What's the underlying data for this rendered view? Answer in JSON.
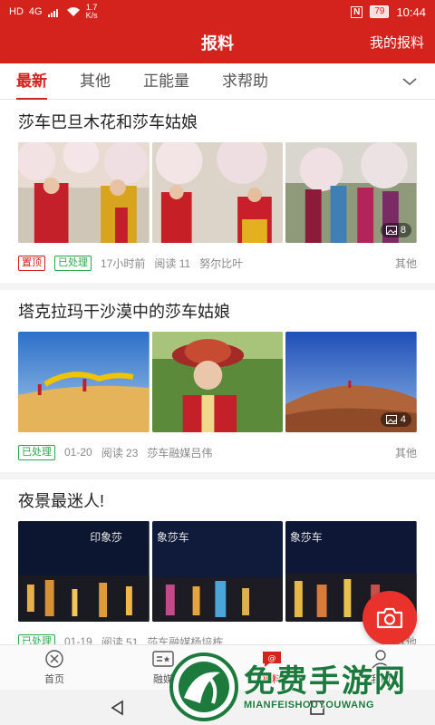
{
  "status_bar": {
    "signal_label": "HD",
    "network": "4G",
    "speed_value": "1.7",
    "speed_unit": "K/s",
    "nfc": "N",
    "battery": "79",
    "time": "10:44"
  },
  "header": {
    "title": "报料",
    "right_link": "我的报料"
  },
  "tabs": [
    {
      "label": "最新",
      "active": true
    },
    {
      "label": "其他",
      "active": false
    },
    {
      "label": "正能量",
      "active": false
    },
    {
      "label": "求帮助",
      "active": false
    }
  ],
  "posts": [
    {
      "title": "莎车巴旦木花和莎车姑娘",
      "image_count": "8",
      "badges": [
        "置顶",
        "已处理"
      ],
      "time": "17小时前",
      "reads": "阅读 11",
      "author": "努尔比叶",
      "category": "其他"
    },
    {
      "title": "塔克拉玛干沙漠中的莎车姑娘",
      "image_count": "4",
      "badges": [
        "已处理"
      ],
      "time": "01-20",
      "reads": "阅读 23",
      "author": "莎车融媒吕伟",
      "category": "其他"
    },
    {
      "title": "夜景最迷人!",
      "badges": [
        "已处理"
      ],
      "time": "01-19",
      "reads": "阅读 51",
      "author": "莎车融媒杨培栋",
      "category": "其他",
      "image_texts": [
        "印象莎",
        "象莎车",
        "象莎车"
      ]
    }
  ],
  "bottom_nav": [
    {
      "label": "首页"
    },
    {
      "label": "融媒"
    },
    {
      "label": "报料"
    },
    {
      "label": "我的"
    }
  ],
  "watermark": {
    "cn": "免费手游网",
    "en": "MIANFEISHOUYOUWANG"
  },
  "colors": {
    "brand": "#d3231c",
    "processed": "#2aa84a"
  }
}
